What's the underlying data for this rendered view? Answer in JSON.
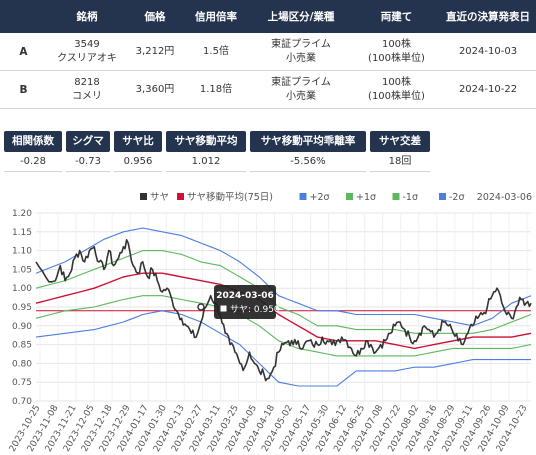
{
  "table": {
    "headers": [
      "",
      "銘柄",
      "価格",
      "信用倍率",
      "上場区分/業種",
      "両建て",
      "直近の決算発表日"
    ],
    "rows": [
      {
        "label": "A",
        "code": "3549",
        "name": "クスリアオキ",
        "price": "3,212円",
        "margin": "1.5倍",
        "market": "東証プライム",
        "sector": "小売業",
        "unit": "100株",
        "unit_sub": "(100株単位)",
        "date": "2024-10-03"
      },
      {
        "label": "B",
        "code": "8218",
        "name": "コメリ",
        "price": "3,360円",
        "margin": "1.18倍",
        "market": "東証プライム",
        "sector": "小売業",
        "unit": "100株",
        "unit_sub": "(100株単位)",
        "date": "2024-10-22"
      }
    ]
  },
  "stats": [
    {
      "label": "相関係数",
      "value": "-0.28"
    },
    {
      "label": "シグマ",
      "value": "-0.73"
    },
    {
      "label": "サヤ比",
      "value": "0.956"
    },
    {
      "label": "サヤ移動平均",
      "value": "1.012"
    },
    {
      "label": "サヤ移動平均乖離率",
      "value": "-5.56%"
    },
    {
      "label": "サヤ交差",
      "value": "18回"
    }
  ],
  "chart_data": {
    "type": "line",
    "date_label": "2024-03-06",
    "ylim": [
      0.7,
      1.2
    ],
    "yticks": [
      "1.20",
      "1.15",
      "1.10",
      "1.05",
      "1.00",
      "0.95",
      "0.90",
      "0.85",
      "0.80",
      "0.75",
      "0.70"
    ],
    "xticks": [
      "2023-10-25",
      "2023-11-08",
      "2023-11-21",
      "2023-12-05",
      "2023-12-18",
      "2023-12-29",
      "2024-01-17",
      "2024-01-30",
      "2024-02-13",
      "2024-02-27",
      "2024-03-11",
      "2024-03-25",
      "2024-04-05",
      "2024-04-18",
      "2024-05-02",
      "2024-05-17",
      "2024-05-30",
      "2024-06-12",
      "2024-06-25",
      "2024-07-08",
      "2024-07-22",
      "2024-08-02",
      "2024-08-16",
      "2024-08-29",
      "2024-09-11",
      "2024-09-26",
      "2024-10-09",
      "2024-10-23"
    ],
    "legend": [
      {
        "name": "サヤ",
        "color": "#333333",
        "symbol": "square"
      },
      {
        "name": "サヤ移動平均(75日)",
        "color": "#cc1133",
        "symbol": "square"
      },
      {
        "name": "+2σ",
        "color": "#4a7fe0",
        "symbol": "square"
      },
      {
        "name": "+1σ",
        "color": "#5cb85c",
        "symbol": "square"
      },
      {
        "name": "-1σ",
        "color": "#5cb85c",
        "symbol": "square"
      },
      {
        "name": "-2σ",
        "color": "#4a7fe0",
        "symbol": "square"
      }
    ],
    "hline": 0.94,
    "tooltip": {
      "date": "2024-03-06",
      "label": "サヤ",
      "value": "0.950"
    },
    "series": [
      {
        "name": "サヤ",
        "color": "#333333",
        "anchors": [
          [
            0,
            1.07
          ],
          [
            1,
            1.03
          ],
          [
            2,
            1.02
          ],
          [
            2.5,
            1.06
          ],
          [
            3,
            1.02
          ],
          [
            3.5,
            1.04
          ],
          [
            4,
            1.08
          ],
          [
            4.5,
            1.1
          ],
          [
            5,
            1.07
          ],
          [
            5.5,
            1.1
          ],
          [
            6,
            1.11
          ],
          [
            6.5,
            1.07
          ],
          [
            7,
            1.05
          ],
          [
            7.5,
            1.1
          ],
          [
            8,
            1.06
          ],
          [
            8.5,
            1.08
          ],
          [
            9,
            1.11
          ],
          [
            9.5,
            1.12
          ],
          [
            10,
            1.06
          ],
          [
            10.5,
            1.04
          ],
          [
            11,
            1.07
          ],
          [
            11.5,
            1.03
          ],
          [
            12,
            1.05
          ],
          [
            12.5,
            1.02
          ],
          [
            13,
            0.99
          ],
          [
            13.5,
            1.0
          ],
          [
            14,
            0.97
          ],
          [
            14.5,
            0.94
          ],
          [
            15,
            0.92
          ],
          [
            15.5,
            0.9
          ],
          [
            16,
            0.88
          ],
          [
            16.5,
            0.87
          ],
          [
            17,
            0.91
          ],
          [
            17.5,
            0.95
          ],
          [
            18,
            0.98
          ],
          [
            18.5,
            0.96
          ],
          [
            19,
            0.93
          ],
          [
            19.5,
            0.88
          ],
          [
            20,
            0.85
          ],
          [
            20.5,
            0.83
          ],
          [
            21,
            0.8
          ],
          [
            21.5,
            0.79
          ],
          [
            22,
            0.83
          ],
          [
            22.5,
            0.8
          ],
          [
            23,
            0.78
          ],
          [
            23.5,
            0.77
          ],
          [
            24,
            0.76
          ],
          [
            24.5,
            0.79
          ],
          [
            25,
            0.83
          ],
          [
            25.5,
            0.85
          ],
          [
            26,
            0.86
          ],
          [
            26.5,
            0.85
          ],
          [
            27,
            0.86
          ],
          [
            27.5,
            0.84
          ],
          [
            28,
            0.86
          ],
          [
            28.5,
            0.85
          ],
          [
            29,
            0.85
          ],
          [
            29.5,
            0.87
          ],
          [
            30,
            0.86
          ],
          [
            30.5,
            0.85
          ],
          [
            31,
            0.86
          ],
          [
            31.5,
            0.87
          ],
          [
            32,
            0.86
          ],
          [
            32.5,
            0.84
          ],
          [
            33,
            0.82
          ],
          [
            33.5,
            0.84
          ],
          [
            34,
            0.86
          ],
          [
            34.5,
            0.85
          ],
          [
            35,
            0.83
          ],
          [
            35.5,
            0.85
          ],
          [
            36,
            0.86
          ],
          [
            36.5,
            0.88
          ],
          [
            37,
            0.9
          ],
          [
            37.5,
            0.91
          ],
          [
            38,
            0.89
          ],
          [
            38.5,
            0.87
          ],
          [
            39,
            0.86
          ],
          [
            39.5,
            0.88
          ],
          [
            40,
            0.9
          ],
          [
            40.5,
            0.89
          ],
          [
            41,
            0.87
          ],
          [
            41.5,
            0.89
          ],
          [
            42,
            0.91
          ],
          [
            42.5,
            0.9
          ],
          [
            43,
            0.88
          ],
          [
            43.5,
            0.86
          ],
          [
            44,
            0.85
          ],
          [
            44.5,
            0.88
          ],
          [
            45,
            0.9
          ],
          [
            45.5,
            0.92
          ],
          [
            46,
            0.93
          ],
          [
            46.5,
            0.95
          ],
          [
            47,
            0.98
          ],
          [
            47.5,
            1.0
          ],
          [
            48,
            0.96
          ],
          [
            48.5,
            0.93
          ],
          [
            49,
            0.92
          ],
          [
            49.5,
            0.95
          ],
          [
            50,
            0.97
          ],
          [
            50.5,
            0.96
          ],
          [
            51,
            0.96
          ]
        ]
      },
      {
        "name": "サヤ移動平均(75日)",
        "color": "#cc1133",
        "anchors": [
          [
            0,
            0.96
          ],
          [
            3,
            0.98
          ],
          [
            6,
            1.0
          ],
          [
            9,
            1.03
          ],
          [
            11,
            1.04
          ],
          [
            13,
            1.04
          ],
          [
            15,
            1.03
          ],
          [
            17,
            1.02
          ],
          [
            19,
            1.01
          ],
          [
            21,
            0.99
          ],
          [
            23,
            0.97
          ],
          [
            25,
            0.93
          ],
          [
            27,
            0.9
          ],
          [
            29,
            0.87
          ],
          [
            31,
            0.86
          ],
          [
            33,
            0.86
          ],
          [
            35,
            0.86
          ],
          [
            37,
            0.85
          ],
          [
            39,
            0.84
          ],
          [
            41,
            0.85
          ],
          [
            43,
            0.86
          ],
          [
            45,
            0.87
          ],
          [
            47,
            0.87
          ],
          [
            49,
            0.87
          ],
          [
            51,
            0.88
          ]
        ]
      },
      {
        "name": "+2σ",
        "color": "#4a7fe0",
        "anchors": [
          [
            0,
            1.04
          ],
          [
            3,
            1.07
          ],
          [
            5,
            1.1
          ],
          [
            7,
            1.13
          ],
          [
            9,
            1.15
          ],
          [
            11,
            1.16
          ],
          [
            13,
            1.15
          ],
          [
            15,
            1.14
          ],
          [
            17,
            1.12
          ],
          [
            19,
            1.1
          ],
          [
            21,
            1.07
          ],
          [
            23,
            1.03
          ],
          [
            25,
            0.98
          ],
          [
            27,
            0.96
          ],
          [
            29,
            0.94
          ],
          [
            31,
            0.94
          ],
          [
            33,
            0.93
          ],
          [
            35,
            0.93
          ],
          [
            37,
            0.93
          ],
          [
            39,
            0.93
          ],
          [
            41,
            0.92
          ],
          [
            43,
            0.91
          ],
          [
            45,
            0.9
          ],
          [
            47,
            0.92
          ],
          [
            49,
            0.96
          ],
          [
            51,
            0.98
          ]
        ]
      },
      {
        "name": "+1σ",
        "color": "#5cb85c",
        "anchors": [
          [
            0,
            1.0
          ],
          [
            3,
            1.02
          ],
          [
            6,
            1.05
          ],
          [
            9,
            1.08
          ],
          [
            11,
            1.1
          ],
          [
            13,
            1.1
          ],
          [
            15,
            1.09
          ],
          [
            17,
            1.07
          ],
          [
            19,
            1.06
          ],
          [
            21,
            1.03
          ],
          [
            23,
            1.0
          ],
          [
            25,
            0.95
          ],
          [
            27,
            0.93
          ],
          [
            29,
            0.9
          ],
          [
            31,
            0.9
          ],
          [
            33,
            0.89
          ],
          [
            35,
            0.89
          ],
          [
            37,
            0.89
          ],
          [
            39,
            0.88
          ],
          [
            41,
            0.88
          ],
          [
            43,
            0.88
          ],
          [
            45,
            0.88
          ],
          [
            47,
            0.89
          ],
          [
            49,
            0.91
          ],
          [
            51,
            0.93
          ]
        ]
      },
      {
        "name": "-1σ",
        "color": "#5cb85c",
        "anchors": [
          [
            0,
            0.92
          ],
          [
            3,
            0.94
          ],
          [
            6,
            0.95
          ],
          [
            9,
            0.97
          ],
          [
            11,
            0.98
          ],
          [
            13,
            0.98
          ],
          [
            15,
            0.97
          ],
          [
            17,
            0.96
          ],
          [
            19,
            0.95
          ],
          [
            21,
            0.93
          ],
          [
            23,
            0.9
          ],
          [
            25,
            0.86
          ],
          [
            27,
            0.84
          ],
          [
            29,
            0.83
          ],
          [
            31,
            0.82
          ],
          [
            33,
            0.82
          ],
          [
            35,
            0.82
          ],
          [
            37,
            0.82
          ],
          [
            39,
            0.82
          ],
          [
            41,
            0.83
          ],
          [
            43,
            0.84
          ],
          [
            45,
            0.84
          ],
          [
            47,
            0.84
          ],
          [
            49,
            0.84
          ],
          [
            51,
            0.85
          ]
        ]
      },
      {
        "name": "-2σ",
        "color": "#4a7fe0",
        "anchors": [
          [
            0,
            0.87
          ],
          [
            3,
            0.88
          ],
          [
            6,
            0.89
          ],
          [
            9,
            0.91
          ],
          [
            11,
            0.93
          ],
          [
            13,
            0.94
          ],
          [
            15,
            0.93
          ],
          [
            17,
            0.91
          ],
          [
            19,
            0.88
          ],
          [
            21,
            0.85
          ],
          [
            23,
            0.8
          ],
          [
            25,
            0.75
          ],
          [
            27,
            0.74
          ],
          [
            29,
            0.74
          ],
          [
            31,
            0.74
          ],
          [
            33,
            0.78
          ],
          [
            35,
            0.78
          ],
          [
            37,
            0.78
          ],
          [
            39,
            0.79
          ],
          [
            41,
            0.79
          ],
          [
            43,
            0.8
          ],
          [
            45,
            0.81
          ],
          [
            47,
            0.81
          ],
          [
            49,
            0.81
          ],
          [
            51,
            0.81
          ]
        ]
      }
    ]
  }
}
